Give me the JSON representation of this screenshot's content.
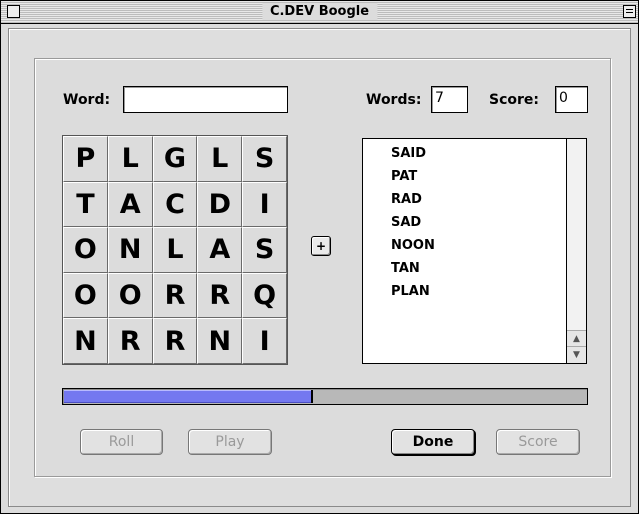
{
  "window": {
    "title": "C.DEV Boogle"
  },
  "form": {
    "word_label": "Word:",
    "word_value": "",
    "words_label": "Words:",
    "words_value": "7",
    "score_label": "Score:",
    "score_value": "0"
  },
  "board": {
    "letters": [
      [
        "P",
        "L",
        "G",
        "L",
        "S"
      ],
      [
        "T",
        "A",
        "C",
        "D",
        "I"
      ],
      [
        "O",
        "N",
        "L",
        "A",
        "S"
      ],
      [
        "O",
        "O",
        "R",
        "R",
        "Q"
      ],
      [
        "N",
        "R",
        "R",
        "N",
        "I"
      ]
    ]
  },
  "add_button": {
    "glyph": "+"
  },
  "word_list": {
    "items": [
      "SAID",
      "PAT",
      "RAD",
      "SAD",
      "NOON",
      "TAN",
      "PLAN"
    ],
    "scroll_up_icon": "▲",
    "scroll_down_icon": "▼"
  },
  "timer": {
    "progress_fraction": 0.477
  },
  "buttons": {
    "roll": "Roll",
    "play": "Play",
    "done": "Done",
    "score": "Score"
  },
  "colors": {
    "progress_fill": "#7478f0",
    "progress_track": "#b8b8b8"
  }
}
